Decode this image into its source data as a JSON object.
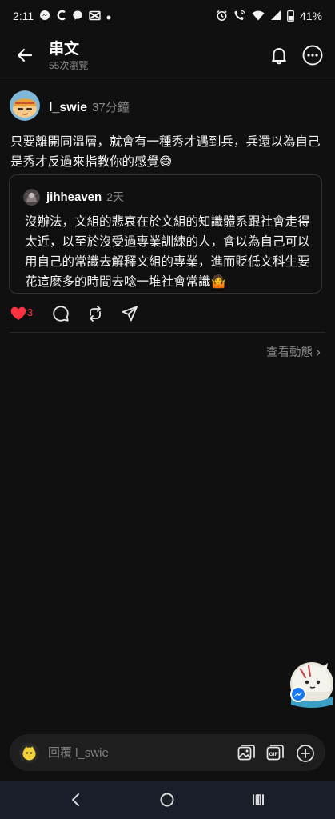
{
  "status_bar": {
    "time": "2:11",
    "battery": "41%"
  },
  "header": {
    "title": "串文",
    "views": "55次瀏覽"
  },
  "post": {
    "username": "l_swie",
    "time_ago": "37分鐘",
    "text": "只要離開同溫層，就會有一種秀才遇到兵，兵還以為自己是秀才反過來指教你的感覺😅"
  },
  "quoted_post": {
    "username": "jihheaven",
    "time_ago": "2天",
    "text": "沒辦法，文組的悲哀在於文組的知識體系跟社會走得太近，以至於沒受過專業訓練的人，會以為自己可以用自己的常識去解釋文組的專業，進而貶低文科生要花這麼多的時間去唸一堆社會常識🤷"
  },
  "actions": {
    "like_count": "3"
  },
  "view_activity": {
    "label": "查看動態",
    "chevron": "›"
  },
  "reply": {
    "placeholder": "回覆 l_swie"
  },
  "icons": {
    "back": "arrow-left-icon",
    "bell": "bell-icon",
    "more": "ellipsis-icon",
    "like": "heart-icon",
    "comment": "comment-icon",
    "repost": "repost-icon",
    "share": "send-icon",
    "image": "image-icon",
    "gif": "gif-icon",
    "add": "plus-circle-icon"
  },
  "colors": {
    "background": "#101010",
    "like": "#ff3040",
    "muted": "#8a8a8a"
  }
}
